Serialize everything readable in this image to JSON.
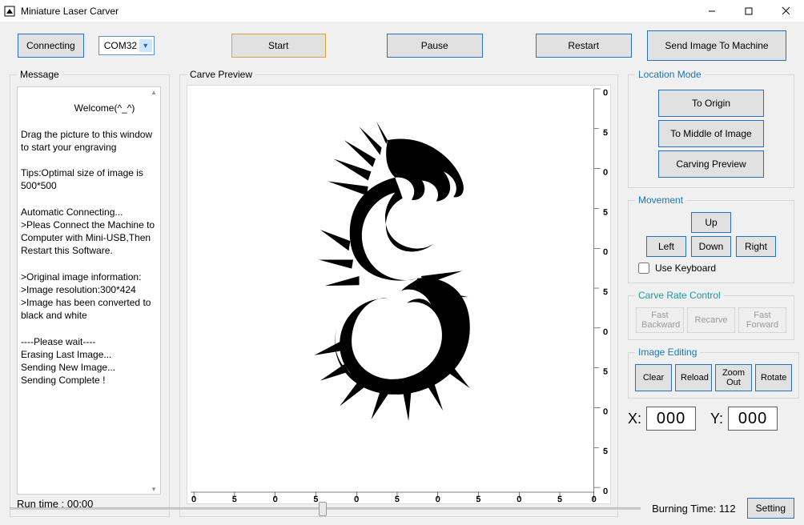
{
  "window": {
    "title": "Miniature Laser Carver"
  },
  "toolbar": {
    "connect": "Connecting",
    "port_selected": "COM32",
    "start": "Start",
    "pause": "Pause",
    "restart": "Restart",
    "send_image": "Send Image To Machine"
  },
  "message_panel": {
    "legend": "Message",
    "body": "          Welcome(^_^)\n\nDrag the picture to this window to start your engraving\n\nTips:Optimal size of image is 500*500\n\nAutomatic Connecting...\n>Pleas Connect the Machine to Computer with Mini-USB,Then Restart this Software.\n\n>Original image information:\n>Image resolution:300*424\n>Image has been converted to black and white\n\n----Please wait----\nErasing Last Image...\nSending New Image...\nSending Complete !",
    "run_time_label": "Run time :  00:00"
  },
  "preview": {
    "legend": "Carve Preview",
    "ruler_ticks": [
      "0",
      "5",
      "0",
      "5",
      "0",
      "5",
      "0",
      "5",
      "0",
      "5",
      "0"
    ]
  },
  "location": {
    "legend": "Location Mode",
    "origin": "To Origin",
    "middle": "To Middle of Image",
    "carve_preview": "Carving Preview"
  },
  "movement": {
    "legend": "Movement",
    "up": "Up",
    "left": "Left",
    "down": "Down",
    "right": "Right",
    "use_keyboard": "Use Keyboard"
  },
  "rate": {
    "legend": "Carve Rate Control",
    "fast_back": "Fast\nBackward",
    "recarve": "Recarve",
    "fast_fwd": "Fast\nForward"
  },
  "editing": {
    "legend": "Image Editing",
    "clear": "Clear",
    "reload": "Reload",
    "zoom_out": "Zoom\nOut",
    "rotate": "Rotate"
  },
  "coords": {
    "x_label": "X:",
    "y_label": "Y:",
    "x_value": "000",
    "y_value": "000"
  },
  "bottom": {
    "burning_time": "Burning Time: 112",
    "setting": "Setting"
  }
}
